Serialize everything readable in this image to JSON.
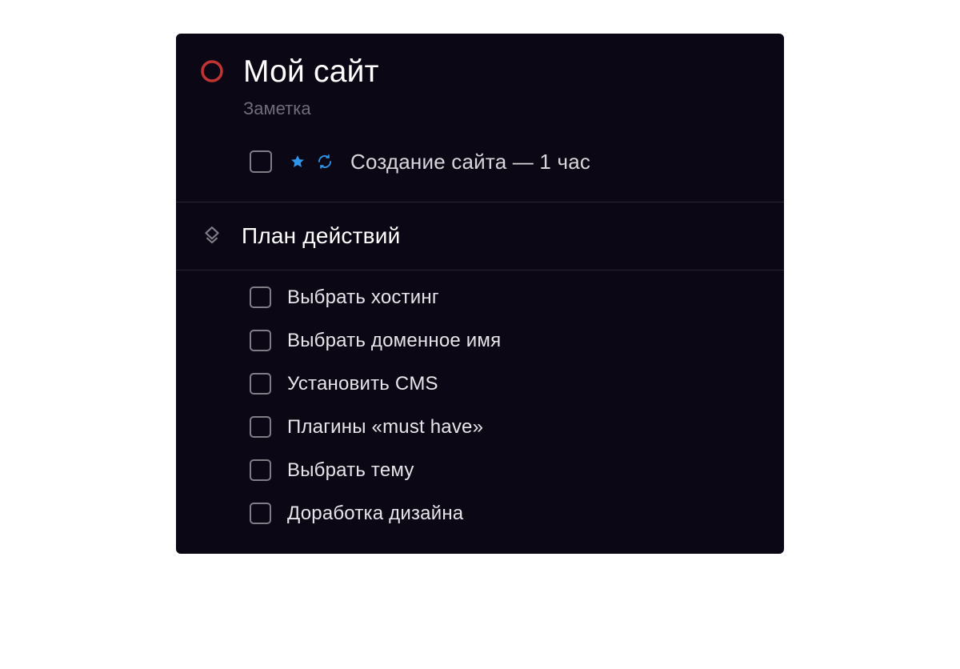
{
  "project": {
    "title": "Мой сайт",
    "subtitle": "Заметка"
  },
  "main_task": {
    "label": "Создание сайта — 1 час",
    "starred": true,
    "repeating": true
  },
  "section": {
    "title": "План действий",
    "tasks": [
      {
        "label": "Выбрать хостинг"
      },
      {
        "label": "Выбрать доменное имя"
      },
      {
        "label": "Установить CMS"
      },
      {
        "label": "Плагины «must have»"
      },
      {
        "label": "Выбрать тему"
      },
      {
        "label": "Доработка дизайна"
      }
    ]
  },
  "colors": {
    "status_ring": "#c53030",
    "accent": "#2f96ea",
    "bg": "#0c0714"
  }
}
